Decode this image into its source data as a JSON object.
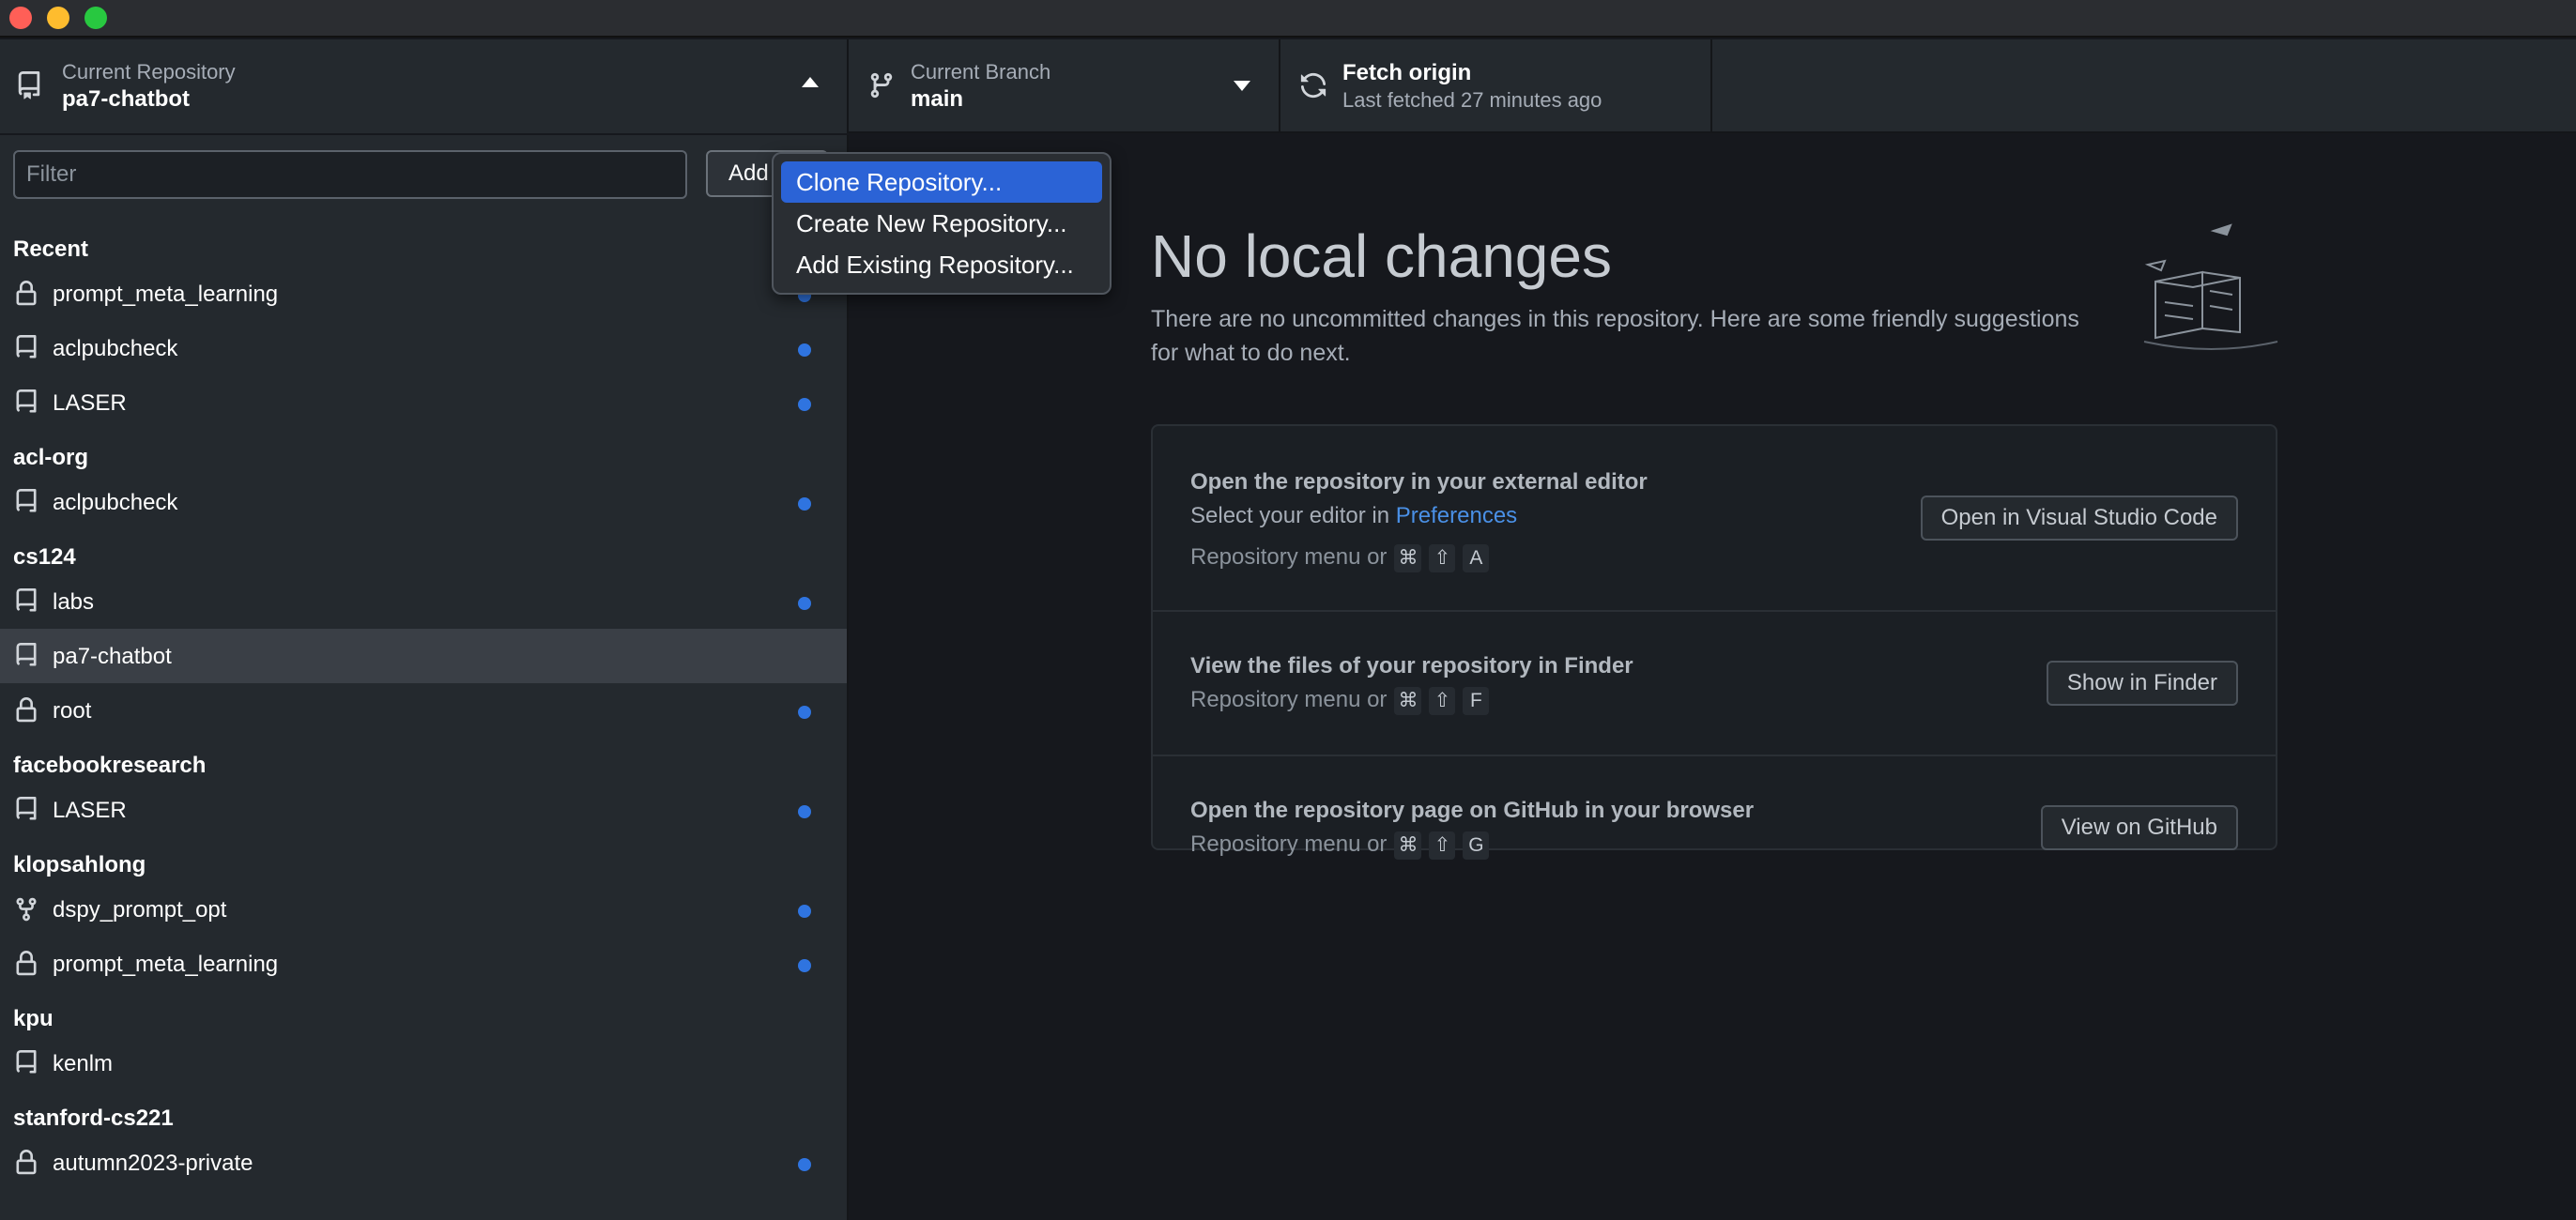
{
  "toolbar": {
    "repository": {
      "label": "Current Repository",
      "value": "pa7-chatbot"
    },
    "branch": {
      "label": "Current Branch",
      "value": "main"
    },
    "fetch": {
      "title": "Fetch origin",
      "subtitle": "Last fetched 27 minutes ago"
    }
  },
  "sidebar": {
    "filter_placeholder": "Filter",
    "add_label": "Add",
    "groups": [
      {
        "header": "Recent",
        "repos": [
          {
            "name": "prompt_meta_learning",
            "icon": "lock-icon",
            "dot": true
          },
          {
            "name": "aclpubcheck",
            "icon": "repo-icon",
            "dot": true
          },
          {
            "name": "LASER",
            "icon": "repo-icon",
            "dot": true
          }
        ]
      },
      {
        "header": "acl-org",
        "repos": [
          {
            "name": "aclpubcheck",
            "icon": "repo-icon",
            "dot": true
          }
        ]
      },
      {
        "header": "cs124",
        "repos": [
          {
            "name": "labs",
            "icon": "repo-icon",
            "dot": true
          },
          {
            "name": "pa7-chatbot",
            "icon": "repo-icon",
            "dot": false,
            "selected": true
          },
          {
            "name": "root",
            "icon": "lock-icon",
            "dot": true
          }
        ]
      },
      {
        "header": "facebookresearch",
        "repos": [
          {
            "name": "LASER",
            "icon": "repo-icon",
            "dot": true
          }
        ]
      },
      {
        "header": "klopsahlong",
        "repos": [
          {
            "name": "dspy_prompt_opt",
            "icon": "fork-icon",
            "dot": true
          },
          {
            "name": "prompt_meta_learning",
            "icon": "lock-icon",
            "dot": true
          }
        ]
      },
      {
        "header": "kpu",
        "repos": [
          {
            "name": "kenlm",
            "icon": "repo-icon",
            "dot": false
          }
        ]
      },
      {
        "header": "stanford-cs221",
        "repos": [
          {
            "name": "autumn2023-private",
            "icon": "lock-icon",
            "dot": true
          }
        ]
      }
    ]
  },
  "add_menu": {
    "items": [
      "Clone Repository...",
      "Create New Repository...",
      "Add Existing Repository..."
    ],
    "active_index": 0
  },
  "main": {
    "title": "No local changes",
    "description": "There are no uncommitted changes in this repository. Here are some friendly suggestions for what to do next.",
    "suggestions": [
      {
        "title": "Open the repository in your external editor",
        "subtitle_prefix": "Select your editor in ",
        "subtitle_link": "Preferences",
        "shortcut_label": "Repository menu or",
        "keys": [
          "⌘",
          "⇧",
          "A"
        ],
        "button": "Open in Visual Studio Code"
      },
      {
        "title": "View the files of your repository in Finder",
        "shortcut_label": "Repository menu or",
        "keys": [
          "⌘",
          "⇧",
          "F"
        ],
        "button": "Show in Finder"
      },
      {
        "title": "Open the repository page on GitHub in your browser",
        "shortcut_label": "Repository menu or",
        "keys": [
          "⌘",
          "⇧",
          "G"
        ],
        "button": "View on GitHub"
      }
    ]
  },
  "colors": {
    "accent": "#2b63d6",
    "dot": "#2f74e0",
    "link": "#4a90e6"
  }
}
